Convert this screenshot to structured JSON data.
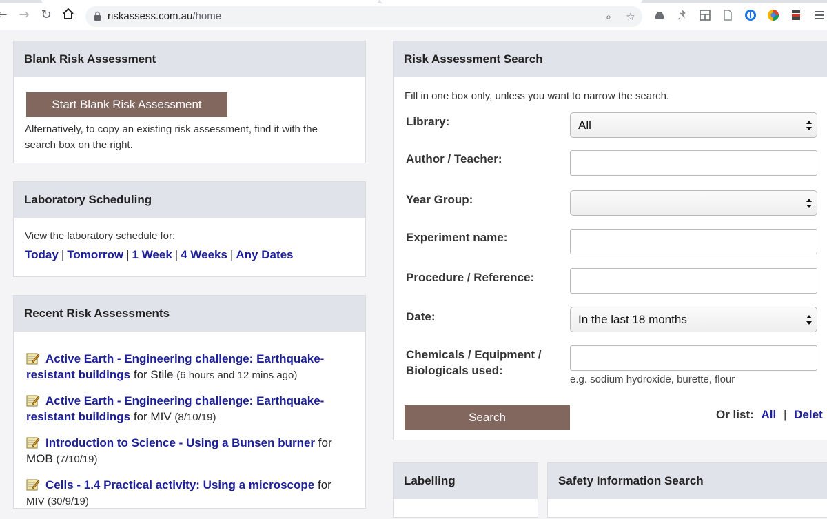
{
  "browser": {
    "url_host": "riskassess.com.au",
    "url_path": "/home"
  },
  "blank": {
    "title": "Blank Risk Assessment",
    "start_button": "Start Blank Risk Assessment",
    "description": "Alternatively, to copy an existing risk assessment, find it with the search box on the right."
  },
  "scheduling": {
    "title": "Laboratory Scheduling",
    "intro": "View the laboratory schedule for:",
    "links": [
      "Today",
      "Tomorrow",
      "1 Week",
      "4 Weeks",
      "Any Dates"
    ],
    "separator": "|"
  },
  "recent": {
    "title": "Recent Risk Assessments",
    "items": [
      {
        "title": "Active Earth - Engineering challenge: Earthquake-resistant buildings",
        "for": "for Stile",
        "when": "(6 hours and 12 mins ago)"
      },
      {
        "title": "Active Earth - Engineering challenge: Earthquake-resistant buildings",
        "for": "for MIV",
        "when": "(8/10/19)"
      },
      {
        "title": "Introduction to Science - Using a Bunsen burner",
        "for": "for MOB",
        "when": "(7/10/19)"
      },
      {
        "title": "Cells - 1.4 Practical activity: Using a microscope",
        "for": "for",
        "when": "MIV (30/9/19)"
      }
    ]
  },
  "search": {
    "title": "Risk Assessment Search",
    "instructions": "Fill in one box only, unless you want to narrow the search.",
    "library_label": "Library:",
    "library_value": "All",
    "author_label": "Author / Teacher:",
    "author_value": "",
    "year_label": "Year Group:",
    "year_value": "",
    "experiment_label": "Experiment name:",
    "experiment_value": "",
    "procedure_label": "Procedure / Reference:",
    "procedure_value": "",
    "date_label": "Date:",
    "date_value": "In the last 18 months",
    "chemicals_label_1": "Chemicals / Equipment /",
    "chemicals_label_2": "Biologicals used:",
    "chemicals_value": "",
    "chemicals_hint": "e.g. sodium hydroxide, burette, flour",
    "search_button": "Search",
    "orlist_label": "Or list:",
    "orlist_all": "All",
    "orlist_sep": "|",
    "orlist_delete": "Delet"
  },
  "labelling": {
    "title": "Labelling"
  },
  "safety": {
    "title": "Safety Information Search"
  },
  "colors": {
    "button_brown": "#82675f",
    "link_blue": "#1c1f9c",
    "panel_header": "#e1e3ea"
  }
}
